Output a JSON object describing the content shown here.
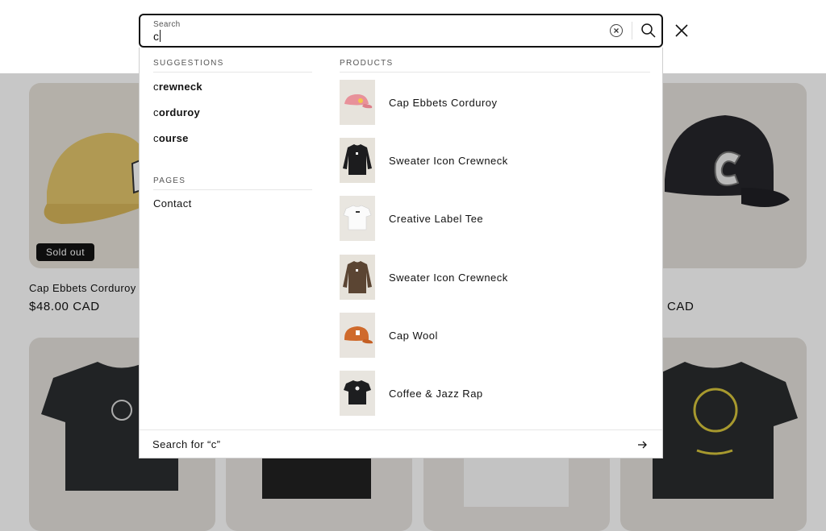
{
  "search": {
    "label": "Search",
    "value": "c",
    "clear_icon": "clear-circle-icon",
    "search_icon": "magnifier-icon",
    "close_icon": "close-x-icon"
  },
  "suggestions": {
    "heading": "SUGGESTIONS",
    "items": [
      {
        "prefix": "c",
        "rest": "rewneck"
      },
      {
        "prefix": "c",
        "rest": "orduroy"
      },
      {
        "prefix": "c",
        "rest": "ourse"
      }
    ]
  },
  "pages": {
    "heading": "PAGES",
    "items": [
      {
        "label": "Contact"
      }
    ]
  },
  "products": {
    "heading": "PRODUCTS",
    "items": [
      {
        "name": "Cap Ebbets Corduroy",
        "thumb": "pink-cap"
      },
      {
        "name": "Sweater Icon Crewneck",
        "thumb": "black-sweater"
      },
      {
        "name": "Creative Label Tee",
        "thumb": "white-tee"
      },
      {
        "name": "Sweater Icon Crewneck",
        "thumb": "brown-sweater"
      },
      {
        "name": "Cap Wool",
        "thumb": "orange-cap"
      },
      {
        "name": "Coffee & Jazz Rap",
        "thumb": "black-tee"
      }
    ]
  },
  "footer": {
    "search_for": "Search for “c”",
    "arrow_icon": "arrow-right-icon"
  },
  "background": {
    "cards": [
      {
        "title": "Cap Ebbets Corduroy",
        "price": "$48.00 CAD",
        "badge": "Sold out"
      },
      {
        "title": "",
        "price": "CAD"
      }
    ]
  },
  "colors": {
    "text": "#121212",
    "overlay": "rgba(0,0,0,0.22)",
    "badge_bg": "#121212"
  }
}
